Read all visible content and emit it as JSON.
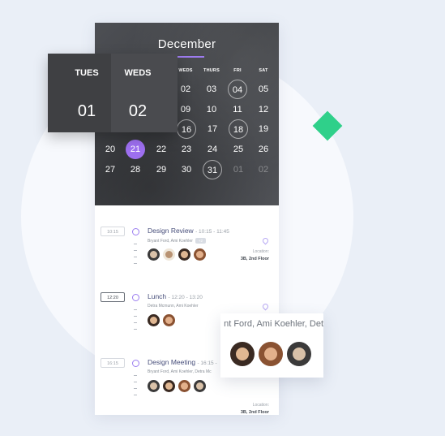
{
  "calendar": {
    "month": "December",
    "weekdays": [
      "WEDS",
      "THURS",
      "FRI",
      "SAT"
    ],
    "rows": [
      [
        "02",
        "03",
        "04",
        "05"
      ],
      [
        "09",
        "10",
        "11",
        "12"
      ],
      [
        "16",
        "17",
        "18",
        "19"
      ],
      [
        "20",
        "21",
        "22",
        "23",
        "24",
        "25",
        "26"
      ],
      [
        "27",
        "28",
        "29",
        "30",
        "31",
        "01",
        "02"
      ]
    ]
  },
  "week_popup": {
    "day1_label": "TUES",
    "day1_num": "01",
    "day2_label": "WEDS",
    "day2_num": "02"
  },
  "events": [
    {
      "time": "10:15",
      "title": "Design Review",
      "range": "- 10:15 - 11:45",
      "people": "Bryant Ford, Ami Koehler",
      "tag": "+2",
      "location_label": "Location:",
      "location": "3B, 2nd Floor"
    },
    {
      "time": "12:20",
      "title": "Lunch",
      "range": "- 12:20 - 13:20",
      "people": "Detra Mcmunn, Ami Koehler"
    },
    {
      "time": "16:15",
      "title": "Design Meeting",
      "range": "- 16:15 -",
      "people": "Bryant Ford, Ami Koehler, Detra Mc",
      "location_label": "Location:",
      "location": "3B, 2nd Floor"
    }
  ],
  "zoom_popup": {
    "names": "nt Ford, Ami Koehler, Det"
  },
  "colors": {
    "accent": "#9d6ff0",
    "diamond": "#2fd08a",
    "background": "#eaeff7"
  }
}
